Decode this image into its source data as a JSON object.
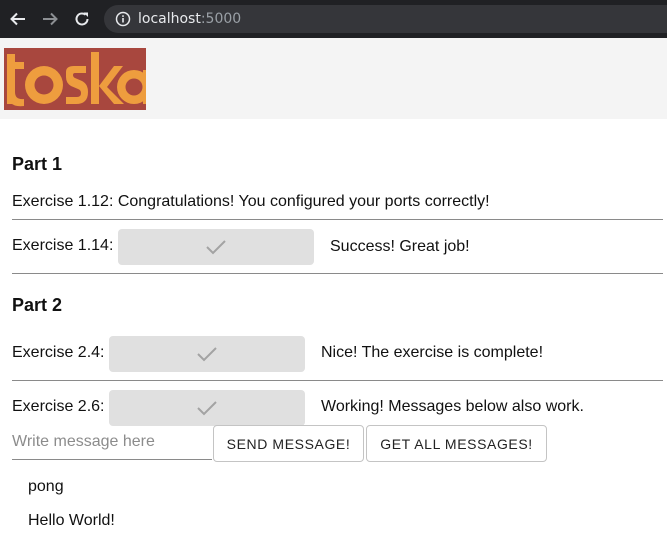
{
  "browser": {
    "url_host": "localhost",
    "url_port": ":5000"
  },
  "header": {
    "logo_text": "toska"
  },
  "part1": {
    "heading": "Part 1",
    "exercise_112": "Exercise 1.12: Congratulations! You configured your ports correctly!",
    "exercise_114": {
      "label": "Exercise 1.14:",
      "message": "Success! Great job!"
    }
  },
  "part2": {
    "heading": "Part 2",
    "exercise_24": {
      "label": "Exercise 2.4:",
      "message": "Nice! The exercise is complete!"
    },
    "exercise_26": {
      "label": "Exercise 2.6:",
      "message": "Working! Messages below also work."
    },
    "message_input": {
      "value": "",
      "placeholder": "Write message here"
    },
    "send_button": "SEND MESSAGE!",
    "get_all_button": "GET ALL MESSAGES!",
    "messages": [
      "pong",
      "Hello World!"
    ]
  },
  "colors": {
    "logo_red": "#a8473e",
    "logo_orange": "#ee9d3e",
    "check_button_bg": "#e0e0e0"
  }
}
